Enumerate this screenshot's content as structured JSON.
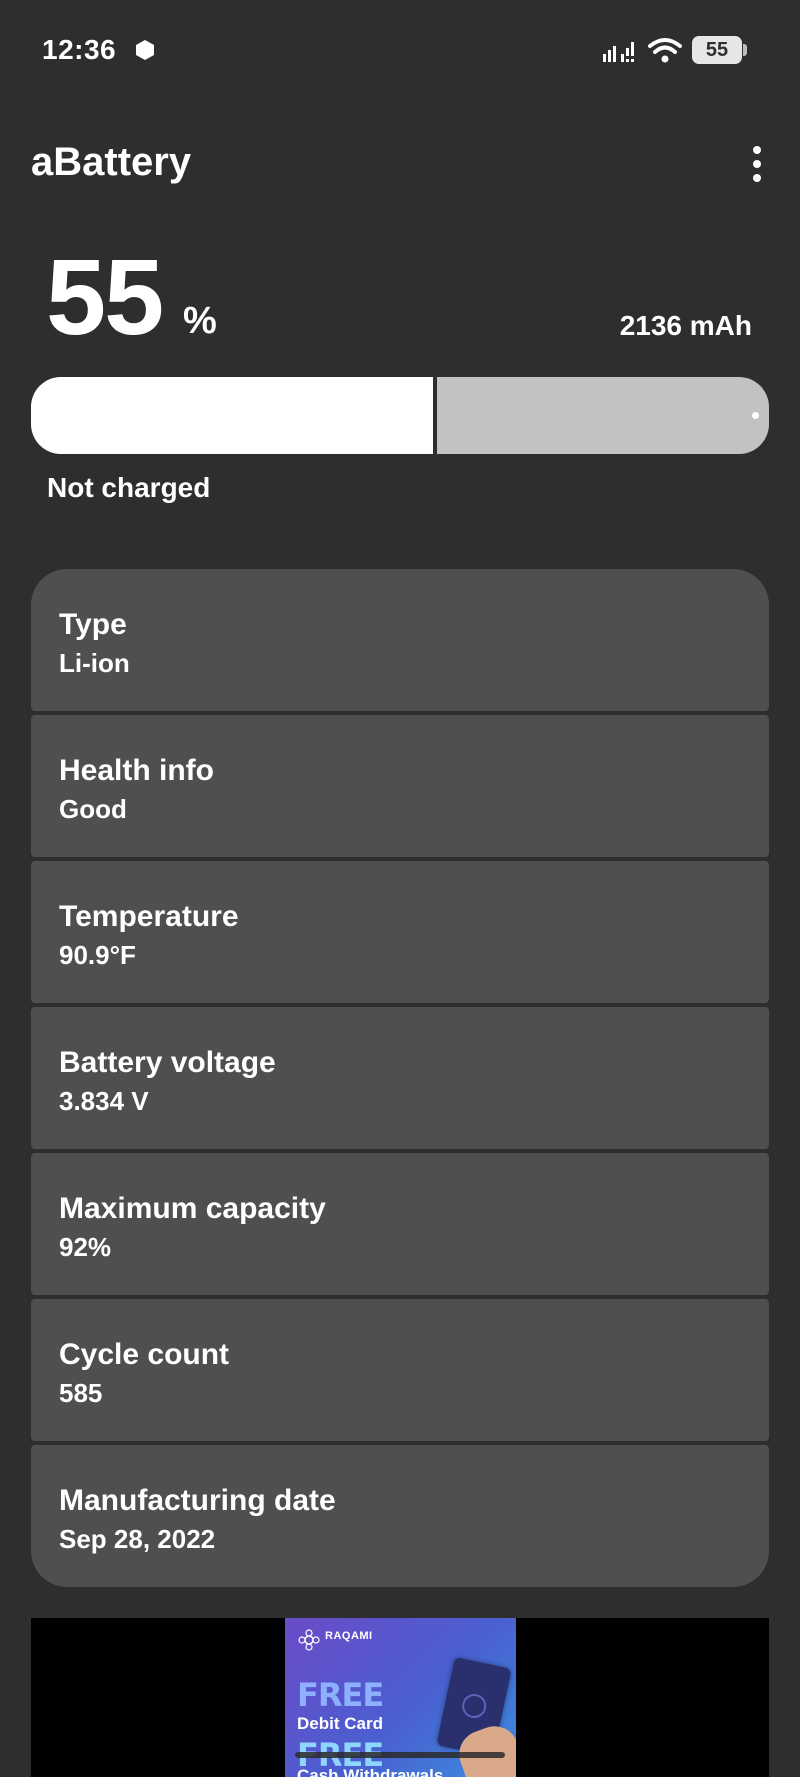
{
  "status_bar": {
    "time": "12:36",
    "battery_level": "55",
    "icons": [
      "hexagon-icon",
      "signal-icon",
      "wifi-icon",
      "battery-icon"
    ]
  },
  "app": {
    "title": "aBattery",
    "menu_icon": "more-vert-icon"
  },
  "battery": {
    "percent": "55",
    "percent_sign": "%",
    "level_fraction": 0.55,
    "capacity": "2136 mAh",
    "status": "Not charged"
  },
  "info_items": [
    {
      "label": "Type",
      "value": "Li-ion"
    },
    {
      "label": "Health info",
      "value": "Good"
    },
    {
      "label": "Temperature",
      "value": "90.9°F"
    },
    {
      "label": "Battery voltage",
      "value": "3.834 V"
    },
    {
      "label": "Maximum capacity",
      "value": "92%"
    },
    {
      "label": "Cycle count",
      "value": "585"
    },
    {
      "label": "Manufacturing date",
      "value": "Sep 28, 2022"
    }
  ],
  "ad": {
    "brand": "RAQAMI",
    "line1": "FREE",
    "line2": "Debit Card",
    "line3": "FREE",
    "line4": "Cash Withdrawals"
  },
  "colors": {
    "background": "#2e2e2e",
    "card": "#4f4f4f",
    "bar_empty": "#c2c2c2",
    "bar_fill": "#ffffff",
    "text": "#ffffff"
  }
}
